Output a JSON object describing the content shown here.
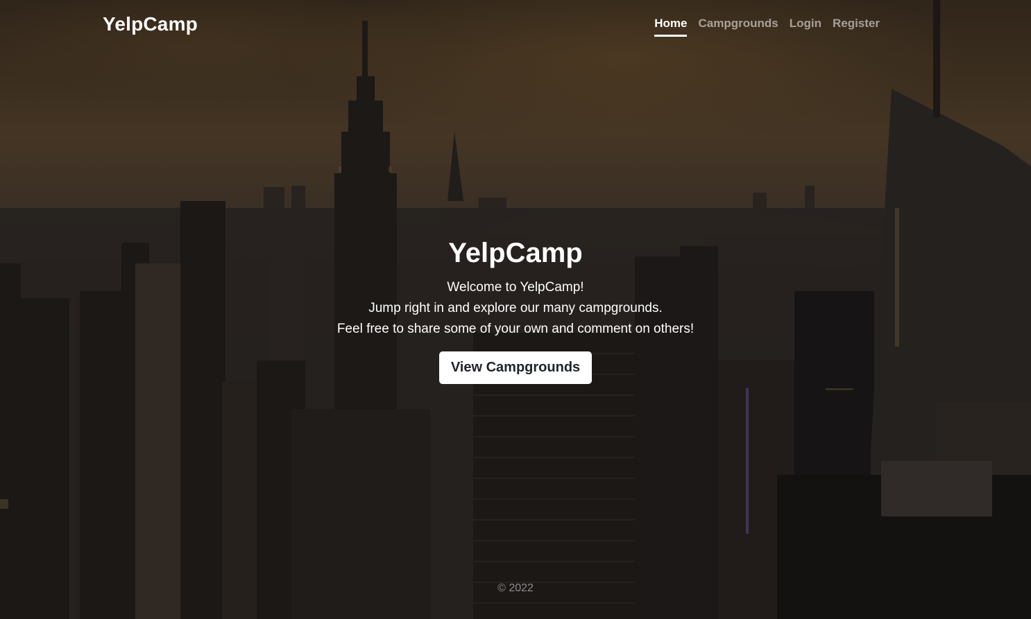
{
  "header": {
    "brand": "YelpCamp",
    "nav": [
      {
        "label": "Home",
        "active": true
      },
      {
        "label": "Campgrounds",
        "active": false
      },
      {
        "label": "Login",
        "active": false
      },
      {
        "label": "Register",
        "active": false
      }
    ]
  },
  "hero": {
    "title": "YelpCamp",
    "lines": [
      "Welcome to YelpCamp!",
      "Jump right in and explore our many campgrounds.",
      "Feel free to share some of your own and comment on others!"
    ],
    "button_label": "View Campgrounds"
  },
  "footer": {
    "text": "© 2022"
  },
  "colors": {
    "overlay": "#000000",
    "button_bg": "#ffffff",
    "button_text": "#212529",
    "nav_inactive": "#9a9a9a"
  }
}
